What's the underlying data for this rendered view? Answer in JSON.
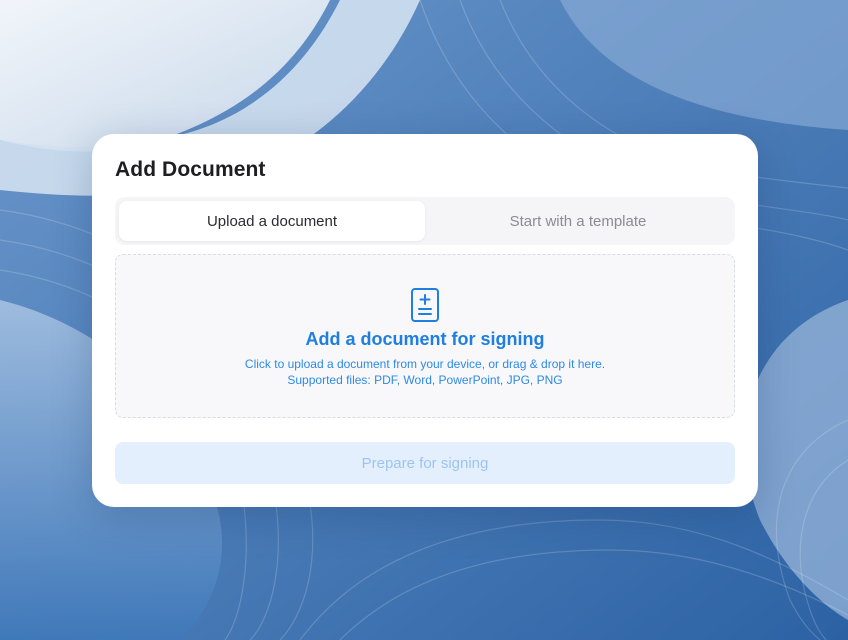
{
  "dialog": {
    "title": "Add Document"
  },
  "tabs": [
    {
      "label": "Upload a document",
      "active": true
    },
    {
      "label": "Start with a template",
      "active": false
    }
  ],
  "dropzone": {
    "icon": "document-add-icon",
    "title": "Add a document for signing",
    "description": "Click to upload a document from your device, or drag & drop it here.",
    "supported": "Supported files: PDF, Word, PowerPoint, JPG, PNG"
  },
  "actions": {
    "prepare_label": "Prepare for signing",
    "prepare_enabled": false
  },
  "colors": {
    "accent": "#1e7fe0",
    "button_disabled_bg": "#e3effd",
    "button_disabled_text": "#9dc4f0"
  }
}
